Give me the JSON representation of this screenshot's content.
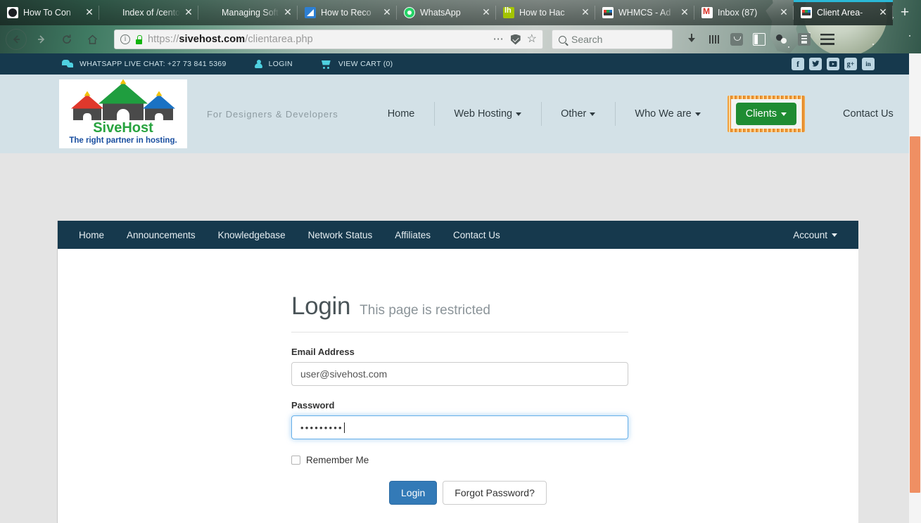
{
  "browser": {
    "tabs": [
      {
        "title": "How To Con",
        "favicon": "github-icon",
        "active": false
      },
      {
        "title": "Index of /cento",
        "favicon": "plain-icon",
        "active": false
      },
      {
        "title": "Managing Soft",
        "favicon": "plain-icon",
        "active": false
      },
      {
        "title": "How to Reco",
        "favicon": "blue-note-icon",
        "active": false
      },
      {
        "title": "WhatsApp",
        "favicon": "whatsapp-icon",
        "active": false
      },
      {
        "title": "How to Hac",
        "favicon": "lh-icon",
        "active": false
      },
      {
        "title": "WHMCS - Ad",
        "favicon": "sivehost-icon",
        "active": false
      },
      {
        "title": "Inbox (87)",
        "favicon": "gmail-icon",
        "active": false
      },
      {
        "title": "Client Area-",
        "favicon": "sivehost-icon",
        "active": true
      }
    ],
    "new_tab_label": "+",
    "close_label": "✕",
    "url": {
      "scheme": "https://",
      "domain": "sivehost.com",
      "path": "/clientarea.php",
      "full": "https://sivehost.com/clientarea.php"
    },
    "search_placeholder": "Search",
    "toolbar_icons": [
      "download-icon",
      "library-icon",
      "pocket-icon",
      "sidebar-icon",
      "atoms-icon",
      "tool-icon",
      "hamburger-menu-icon"
    ]
  },
  "topbar": {
    "whatsapp_label": "WHATSAPP LIVE CHAT: +27 73 841 5369",
    "login_label": "LOGIN",
    "cart_label": "VIEW CART (0)",
    "social": [
      {
        "name": "facebook-icon",
        "glyph": "f"
      },
      {
        "name": "twitter-icon",
        "glyph": "ᴠ"
      },
      {
        "name": "youtube-icon",
        "glyph": "▶"
      },
      {
        "name": "googleplus-icon",
        "glyph": "g+"
      },
      {
        "name": "linkedin-icon",
        "glyph": "in"
      }
    ]
  },
  "logo": {
    "name": "SiveHost",
    "tagline": "The right partner in hosting."
  },
  "mainnav": {
    "tagline": "For Designers & Developers",
    "items": [
      {
        "label": "Home",
        "caret": false
      },
      {
        "label": "Web Hosting",
        "caret": true
      },
      {
        "label": "Other",
        "caret": true
      },
      {
        "label": "Who We are",
        "caret": true
      }
    ],
    "clients_label": "Clients",
    "contact_label": "Contact Us"
  },
  "whmcs_nav": {
    "items": [
      "Home",
      "Announcements",
      "Knowledgebase",
      "Network Status",
      "Affiliates",
      "Contact Us"
    ],
    "account_label": "Account"
  },
  "login": {
    "title": "Login",
    "subtitle": "This page is restricted",
    "email_label": "Email Address",
    "email_value": "user@sivehost.com",
    "password_label": "Password",
    "password_masked": "•••••••••",
    "remember_label": "Remember Me",
    "submit_label": "Login",
    "forgot_label": "Forgot Password?"
  },
  "colors": {
    "brand_dark": "#16394d",
    "accent_cyan": "#4fd0e0",
    "clients_green": "#1f8c32",
    "primary_blue": "#337ab7",
    "scrollbar": "#ef8f63"
  }
}
